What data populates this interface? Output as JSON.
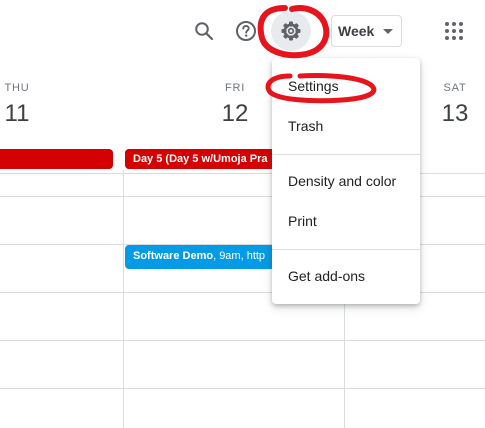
{
  "toolbar": {
    "view_label": "Week",
    "icons": [
      "search-icon",
      "help-icon",
      "gear-icon",
      "chevron-down-icon",
      "apps-grid-icon"
    ]
  },
  "days": [
    {
      "name": "THU",
      "number": "11"
    },
    {
      "name": "FRI",
      "number": "12"
    },
    {
      "name": "SAT",
      "number": "13"
    }
  ],
  "events": {
    "allday_thu": "",
    "allday_fri": "Day 5 (Day 5 w/Umoja Pra",
    "demo": {
      "title": "Software Demo",
      "detail": ", 9am, http"
    }
  },
  "settings_menu": {
    "items": [
      "Settings",
      "Trash",
      "Density and color",
      "Print",
      "Get add-ons"
    ]
  },
  "colors": {
    "allday_event": "#d50000",
    "demo_event": "#039be5",
    "annotation": "#e8141c"
  }
}
